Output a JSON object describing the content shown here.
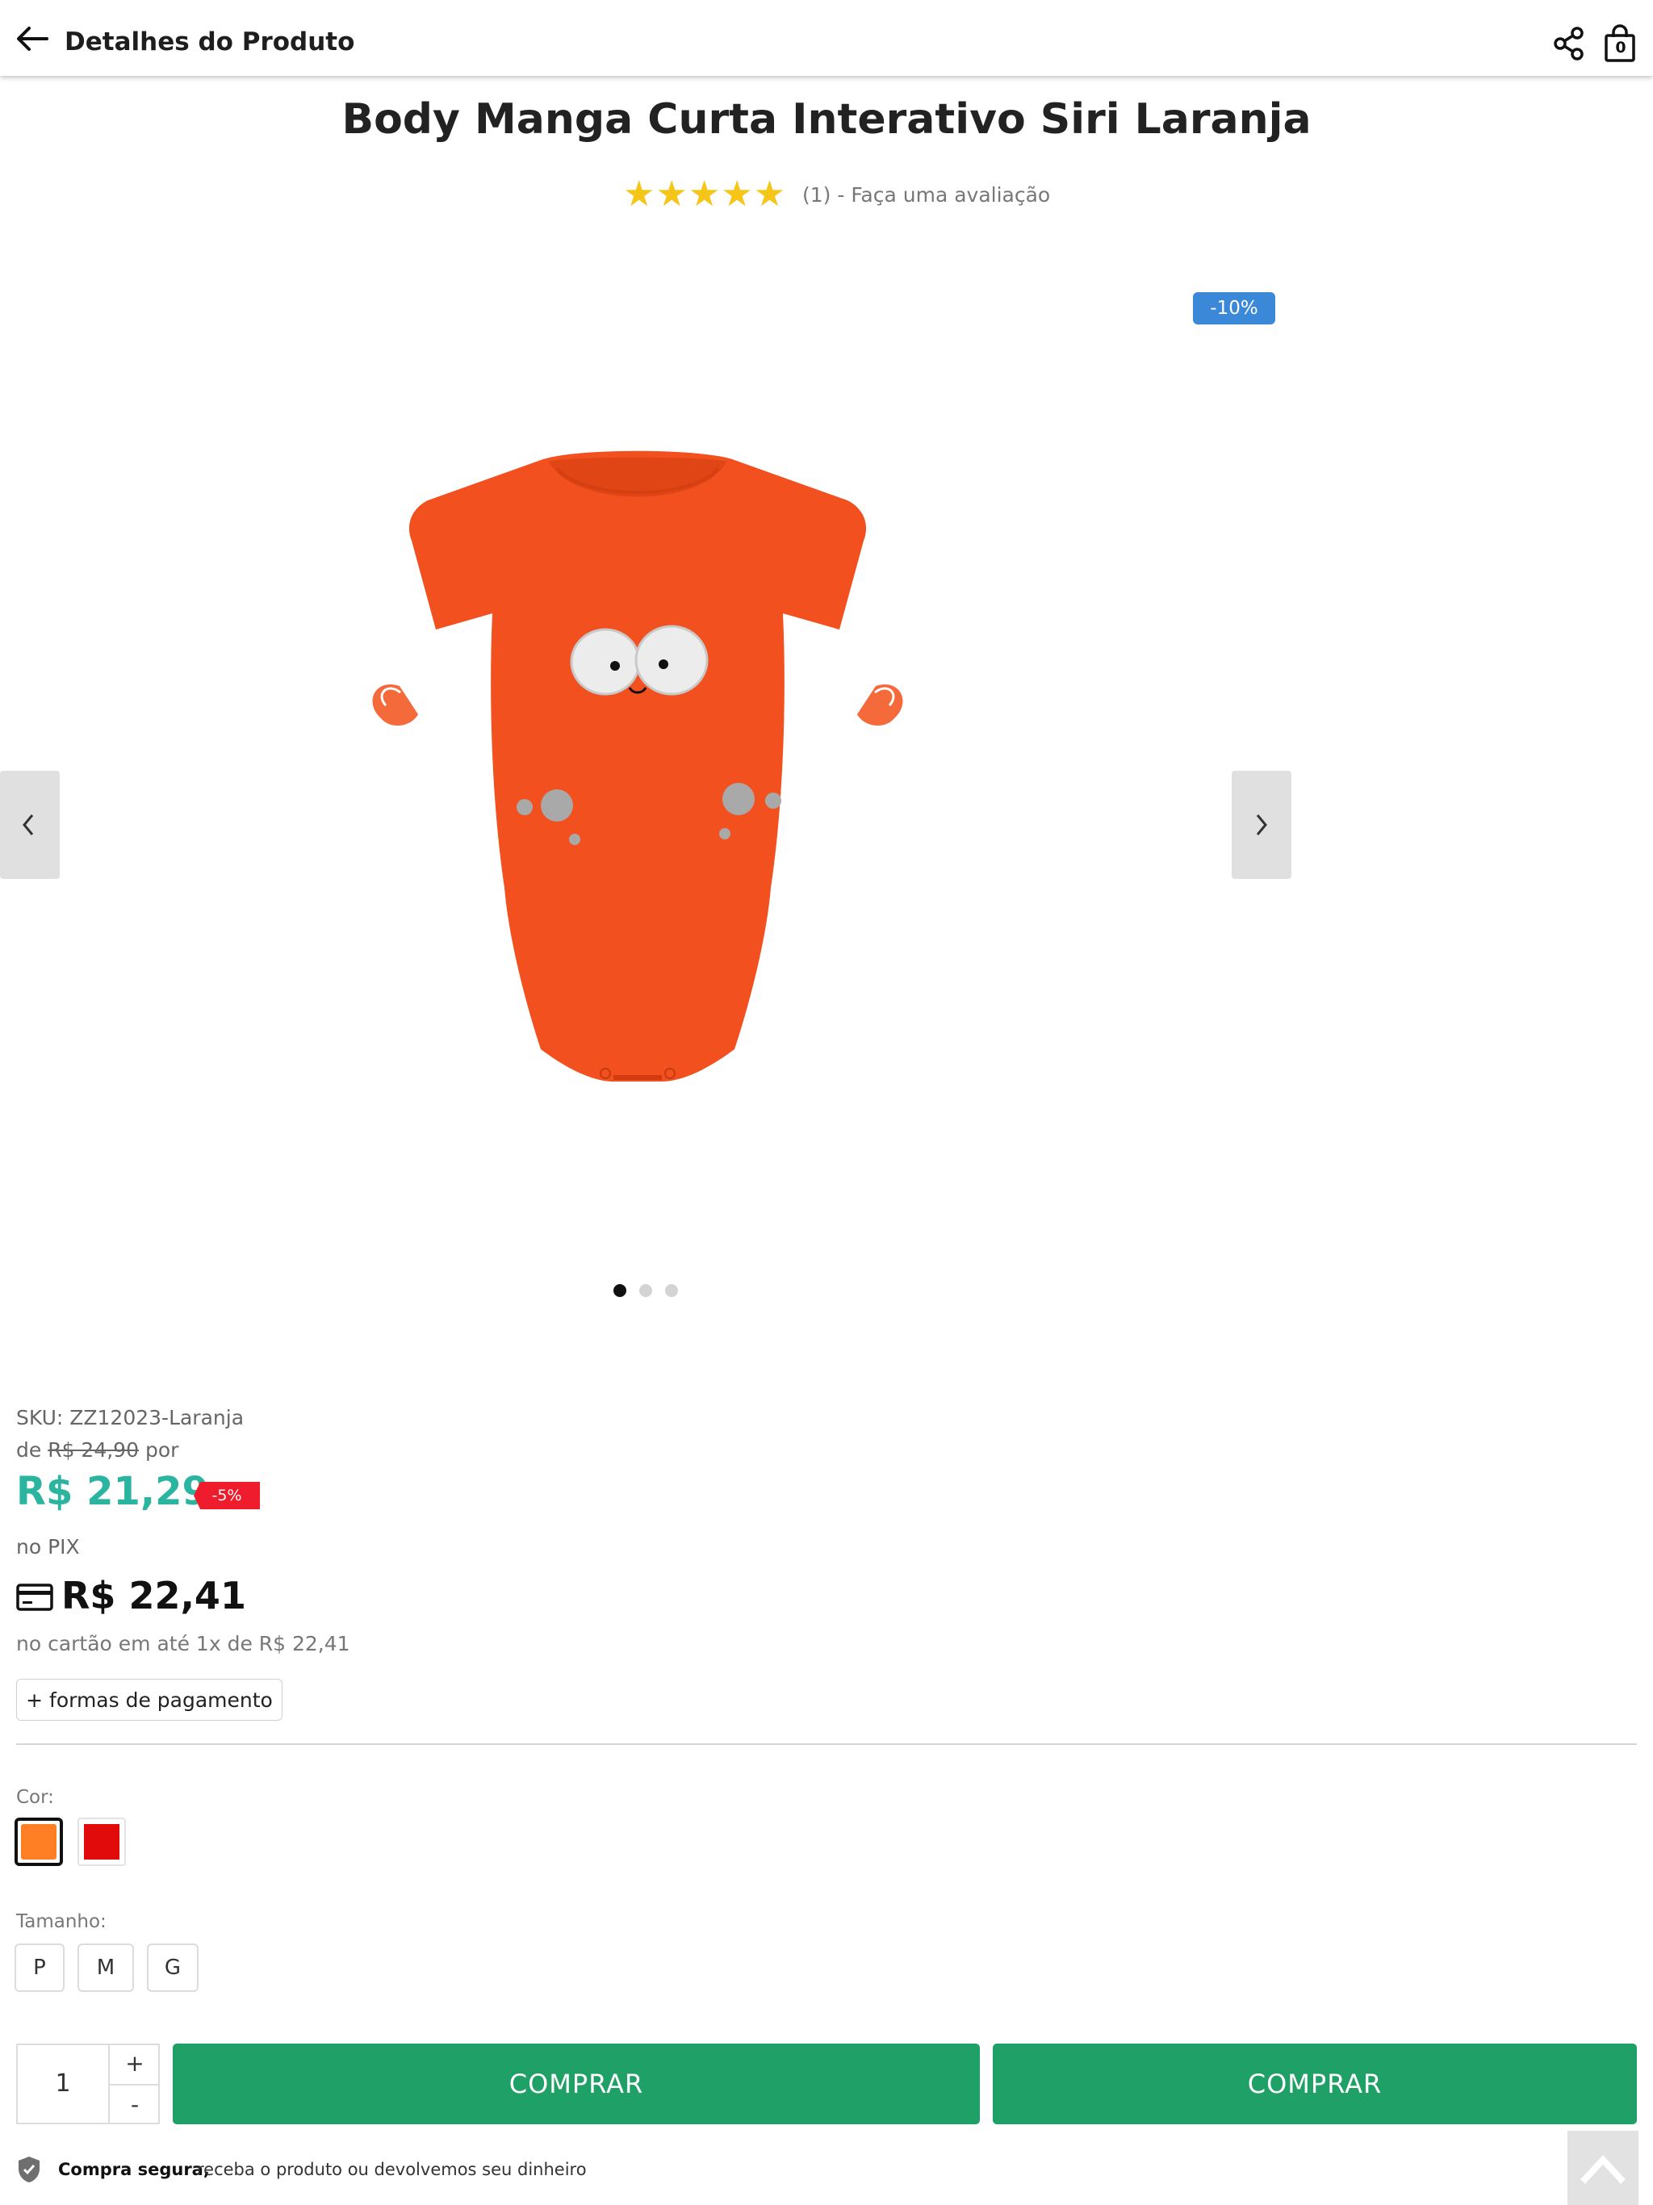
{
  "header": {
    "title": "Detalhes do Produto",
    "back_icon": "arrow-left-icon",
    "share_icon": "share-icon",
    "bag_icon": "shopping-bag-icon",
    "bag_count": "0"
  },
  "product": {
    "title": "Body Manga Curta Interativo Siri Laranja",
    "rating_stars": "★★★★★",
    "rating_value": 5,
    "reviews_text": "(1) - Faça uma avaliação"
  },
  "gallery": {
    "discount_badge": "-10%",
    "image_alt": "orange-crab-baby-bodysuit",
    "slide_count": 3,
    "active_slide": 1,
    "prev_icon": "chevron-left-icon",
    "next_icon": "chevron-right-icon"
  },
  "pricing": {
    "sku": "SKU: ZZ12023-Laranja",
    "old_price_prefix": "de",
    "old_price": "R$ 24,90",
    "old_price_suffix": "por",
    "pix_price": "R$ 21,29",
    "pix_discount": "-5%",
    "pix_label": "no PIX",
    "card_icon": "credit-card-icon",
    "card_price": "R$ 22,41",
    "installment_text": "no cartão em até 1x de R$ 22,41",
    "payment_button": "+ formas de pagamento"
  },
  "variations": {
    "color_label": "Cor:",
    "colors": [
      {
        "name": "Laranja",
        "hex": "#ff7f24",
        "selected": true
      },
      {
        "name": "Vermelho",
        "hex": "#e10b0b",
        "selected": false
      }
    ],
    "size_label": "Tamanho:",
    "sizes": [
      "P",
      "M",
      "G"
    ]
  },
  "purchase": {
    "quantity": "1",
    "plus": "+",
    "minus": "-",
    "buy_button": "COMPRAR",
    "buy_button_2": "COMPRAR"
  },
  "footer": {
    "shield_icon": "shield-check-icon",
    "secure_bold": "Compra segura,",
    "secure_text": "receba o produto ou devolvemos seu dinheiro",
    "scroll_top_icon": "chevron-up-icon"
  },
  "colors": {
    "pix_price": "#2bb5a0",
    "buy_button": "#1fa066",
    "discount_badge": "#3b88d8",
    "pix_badge": "#ee1c2d",
    "stars": "#f5c518"
  }
}
